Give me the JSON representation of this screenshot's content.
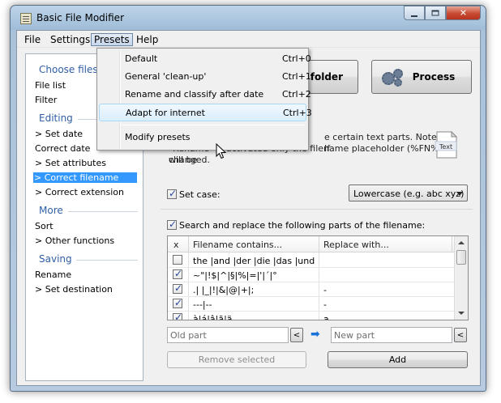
{
  "window": {
    "title": "Basic File Modifier"
  },
  "menubar": [
    "File",
    "Settings",
    "Presets",
    "Help"
  ],
  "presets_menu": {
    "items": [
      {
        "label": "Default",
        "shortcut": "Ctrl+0"
      },
      {
        "label": "General 'clean-up'",
        "shortcut": "Ctrl+1"
      },
      {
        "label": "Rename and classify after date",
        "shortcut": "Ctrl+2"
      },
      {
        "label": "Adapt for internet",
        "shortcut": "Ctrl+3"
      }
    ],
    "modify": "Modify presets"
  },
  "sidebar": {
    "choose_files": {
      "header": "Choose files",
      "items": [
        "File list",
        "Filter"
      ]
    },
    "editing": {
      "header": "Editing",
      "items": [
        "> Set date",
        "Correct date",
        "> Set attributes",
        "> Correct filename",
        "> Correct extension"
      ]
    },
    "more": {
      "header": "More",
      "items": [
        "Sort",
        "> Other functions"
      ]
    },
    "saving": {
      "header": "Saving",
      "items": [
        "Rename",
        "> Set destination"
      ]
    }
  },
  "toolbar": {
    "folder_label": "folder",
    "process_label": "Process"
  },
  "note": {
    "line1": "e certain text parts. Note: If",
    "line2": "\"Rename\" is activated only the filename placeholder (%FN%) will be",
    "line3": "changed."
  },
  "set_case": {
    "label": "Set case:",
    "checked": true,
    "selected": "Lowercase  (e.g. abc xyz)"
  },
  "search_replace": {
    "label": "Search and replace the following parts of the filename:",
    "checked": true,
    "columns": [
      "x",
      "Filename contains...",
      "Replace with..."
    ],
    "rows": [
      {
        "checked": false,
        "contains": "the |and |der |die |das |und |ei...",
        "replace": ""
      },
      {
        "checked": true,
        "contains": "~\"|!$|^|§|%|=|'|´|°",
        "replace": ""
      },
      {
        "checked": true,
        "contains": ".| |_|!|&|@|+|;",
        "replace": "-"
      },
      {
        "checked": true,
        "contains": "---|--",
        "replace": "-"
      },
      {
        "checked": true,
        "contains": "à|á|â|ã|ä",
        "replace": "a"
      }
    ]
  },
  "inputs": {
    "old_placeholder": "Old part",
    "new_placeholder": "New part",
    "btn_lt": "<"
  },
  "buttons": {
    "remove": "Remove selected",
    "add": "Add"
  },
  "icons": {
    "app": "notepad-icon",
    "process": "gears-icon",
    "text": "text-document-icon",
    "arrow": "arrow-right-icon"
  },
  "colors": {
    "selection": "#3399ff",
    "section_header": "#2f5ea6"
  }
}
